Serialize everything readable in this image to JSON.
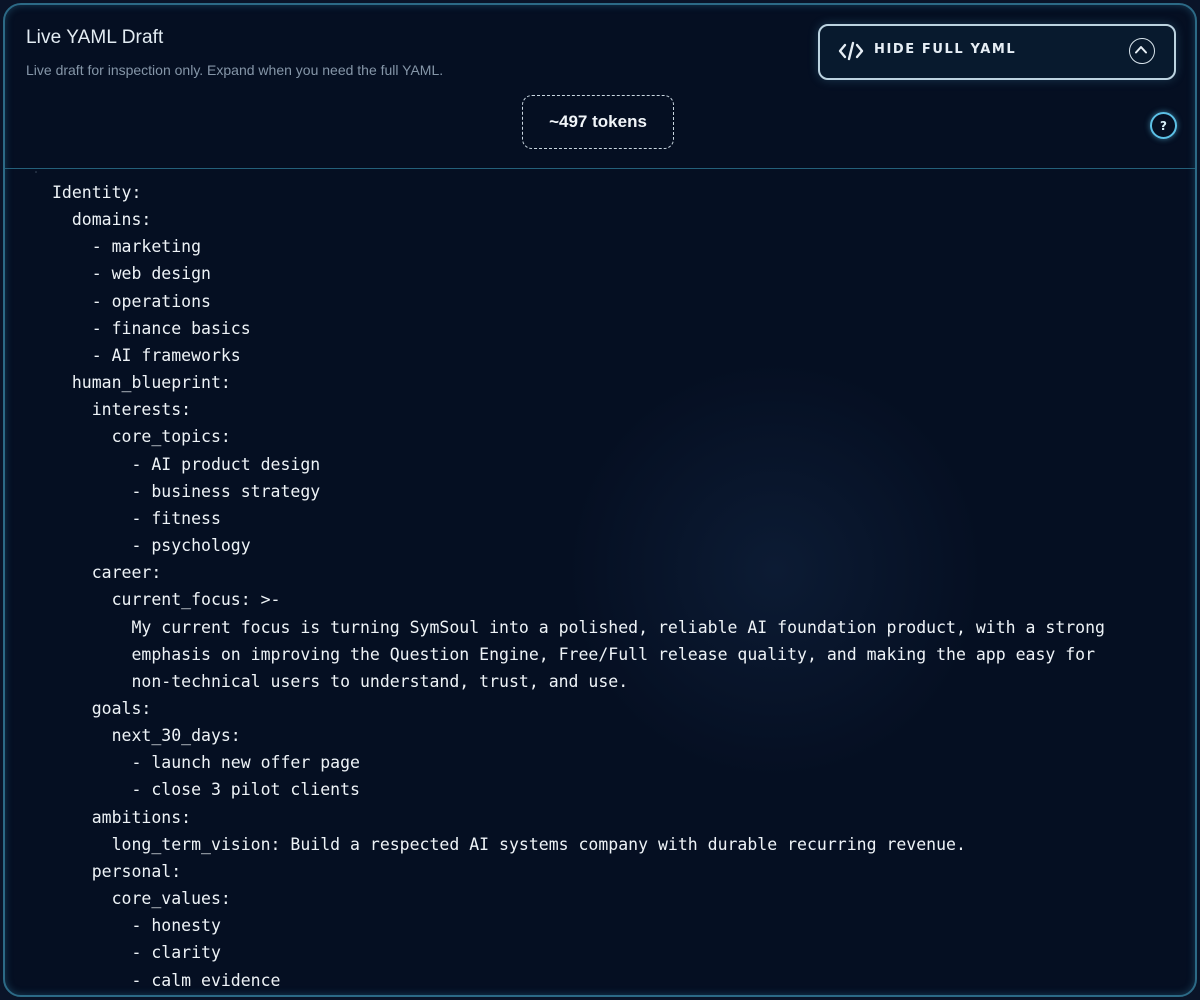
{
  "header": {
    "title": "Live YAML Draft",
    "subtitle": "Live draft for inspection only. Expand when you need the full YAML.",
    "toggle_label": "HIDE FULL YAML",
    "token_count": "~497 tokens",
    "help_label": "?"
  },
  "yaml": {
    "lines": [
      "Identity:",
      "  domains:",
      "    - marketing",
      "    - web design",
      "    - operations",
      "    - finance basics",
      "    - AI frameworks",
      "  human_blueprint:",
      "    interests:",
      "      core_topics:",
      "        - AI product design",
      "        - business strategy",
      "        - fitness",
      "        - psychology",
      "    career:",
      "      current_focus: >-",
      "        My current focus is turning SymSoul into a polished, reliable AI foundation product, with a strong",
      "        emphasis on improving the Question Engine, Free/Full release quality, and making the app easy for",
      "        non-technical users to understand, trust, and use.",
      "    goals:",
      "      next_30_days:",
      "        - launch new offer page",
      "        - close 3 pilot clients",
      "    ambitions:",
      "      long_term_vision: Build a respected AI systems company with durable recurring revenue.",
      "    personal:",
      "      core_values:",
      "        - honesty",
      "        - clarity",
      "        - calm evidence"
    ]
  }
}
